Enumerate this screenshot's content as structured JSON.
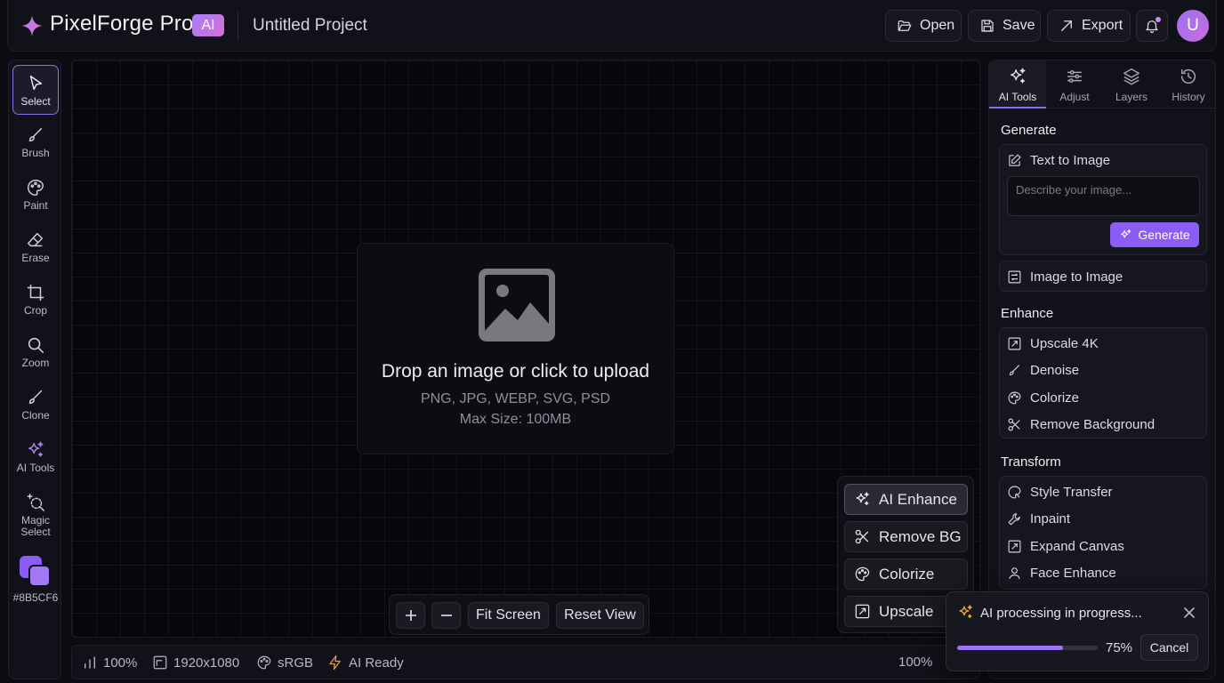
{
  "app": {
    "name": "PixelForge Pro",
    "badge": "AI",
    "project_title": "Untitled Project",
    "accent_color": "#8B5CF6"
  },
  "header": {
    "buttons": [
      {
        "label": "Open",
        "icon": "folder-open-icon"
      },
      {
        "label": "Save",
        "icon": "save-icon"
      },
      {
        "label": "Export",
        "icon": "export-arrow-icon"
      }
    ],
    "notification_icon": "bell-icon",
    "avatar_initial": "U"
  },
  "toolbar": {
    "tools": [
      {
        "label": "Select",
        "icon": "cursor-icon",
        "active": true
      },
      {
        "label": "Brush",
        "icon": "brush-icon"
      },
      {
        "label": "Paint",
        "icon": "palette-icon"
      },
      {
        "label": "Erase",
        "icon": "eraser-icon"
      },
      {
        "label": "Crop",
        "icon": "crop-icon"
      },
      {
        "label": "Zoom",
        "icon": "magnifier-icon"
      },
      {
        "label": "Clone",
        "icon": "clone-brush-icon"
      },
      {
        "label": "AI Tools",
        "icon": "sparkles-icon"
      },
      {
        "label": "Magic Select",
        "icon": "magic-select-icon"
      }
    ],
    "color_swatch": {
      "value": "#8B5CF6",
      "label": "#8B5CF6"
    }
  },
  "canvas": {
    "dropzone": {
      "icon": "image-icon",
      "title": "Drop an image or click to upload",
      "formats": "PNG, JPG, WEBP, SVG, PSD",
      "max_size": "Max Size: 100MB"
    },
    "zoom_controls": {
      "zoom_in_icon": "plus-icon",
      "zoom_out_icon": "minus-icon",
      "fit_label": "Fit Screen",
      "reset_label": "Reset View"
    },
    "quick_actions": [
      {
        "label": "AI Enhance",
        "icon": "sparkles-icon",
        "active": true
      },
      {
        "label": "Remove BG",
        "icon": "scissors-icon"
      },
      {
        "label": "Colorize",
        "icon": "palette-icon"
      },
      {
        "label": "Upscale",
        "icon": "expand-icon"
      }
    ]
  },
  "statusbar": {
    "zoom": "100%",
    "dimensions": "1920x1080",
    "color_space": "sRGB",
    "ai_status": "AI Ready",
    "zoom_right": "100%"
  },
  "panel": {
    "tabs": [
      {
        "label": "AI Tools",
        "icon": "sparkles-icon",
        "active": true
      },
      {
        "label": "Adjust",
        "icon": "sliders-icon"
      },
      {
        "label": "Layers",
        "icon": "layers-icon"
      },
      {
        "label": "History",
        "icon": "history-icon"
      }
    ],
    "generate": {
      "title": "Generate",
      "text_to_image": "Text to Image",
      "prompt_placeholder": "Describe your image...",
      "generate_button": "Generate",
      "image_to_image": "Image to Image"
    },
    "enhance": {
      "title": "Enhance",
      "items": [
        "Upscale 4K",
        "Denoise",
        "Colorize",
        "Remove Background"
      ]
    },
    "transform": {
      "title": "Transform",
      "items": [
        "Style Transfer",
        "Inpaint",
        "Expand Canvas",
        "Face Enhance"
      ]
    }
  },
  "processing": {
    "message": "AI processing in progress...",
    "progress_fraction": 0.75,
    "progress_label": "75%",
    "cancel_label": "Cancel"
  }
}
